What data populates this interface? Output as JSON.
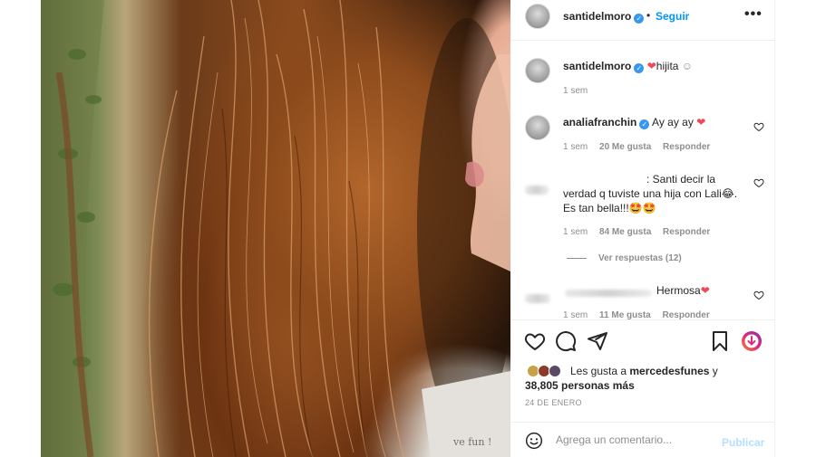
{
  "post": {
    "author": "santidelmoro",
    "follow_label": "Seguir",
    "dot": "•",
    "more": "•••"
  },
  "caption": {
    "author": "santidelmoro",
    "text": "hijita",
    "emoji_heart": "❤",
    "emoji_smile": "☺",
    "time": "1 sem"
  },
  "comments": [
    {
      "author": "analiafranchin",
      "text": "Ay ay ay",
      "emoji": "❤",
      "time": "1 sem",
      "likes": "20 Me gusta",
      "reply": "Responder"
    },
    {
      "author": "",
      "text_line1": ": Santi decir la",
      "text_line2": "verdad q tuviste una hija con Lali😂.",
      "text_line3": "Es tan bella!!!🤩🤩",
      "time": "1 sem",
      "likes": "84 Me gusta",
      "reply": "Responder",
      "view_replies": "Ver respuestas (12)"
    },
    {
      "author": "",
      "text": "Hermosa",
      "emoji": "❤",
      "time": "1 sem",
      "likes": "11 Me gusta",
      "reply": "Responder"
    }
  ],
  "likes_summary": {
    "prefix": "Les gusta a",
    "user": "mercedesfunes",
    "connector": "y",
    "count": "38,805 personas más"
  },
  "date": "24 DE ENERO",
  "add_comment": {
    "placeholder": "Agrega un comentario...",
    "publish_label": "Publicar"
  },
  "colors": {
    "accent": "#0095f6",
    "heart": "#ed4956",
    "muted": "#8e8e8e"
  },
  "icons": [
    "heart-icon",
    "comment-icon",
    "share-icon",
    "bookmark-icon",
    "emoji-icon",
    "verified-icon"
  ]
}
